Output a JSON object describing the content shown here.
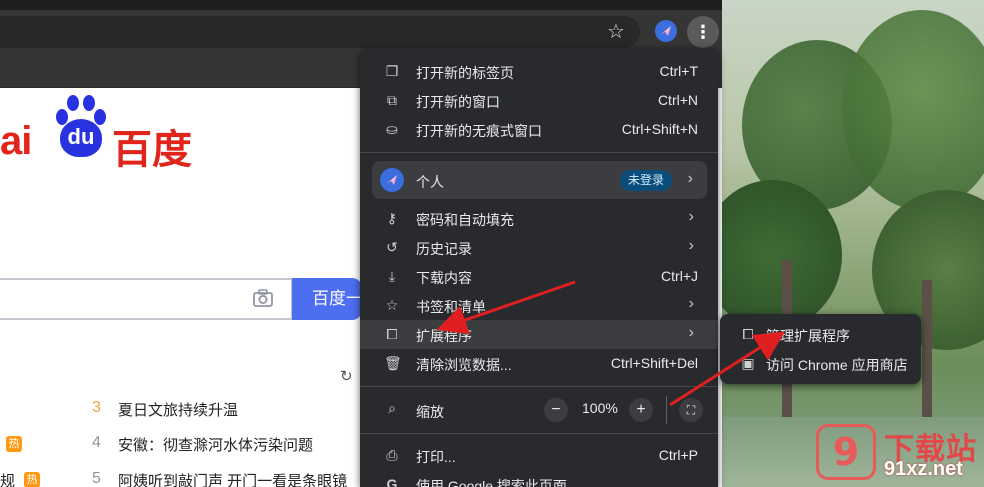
{
  "browser": {
    "star_icon": "star-icon",
    "menu_icon": "three-dots-vertical-icon"
  },
  "page": {
    "logo_latin": "ai",
    "logo_paw_text": "du",
    "logo_chinese": "百度",
    "search_button": "百度一",
    "hot_list": [
      {
        "num": "3",
        "text": "夏日文旅持续升温"
      },
      {
        "num": "4",
        "text": "安徽：彻查滁河水体污染问题"
      },
      {
        "num": "5",
        "text": "阿姨听到敲门声 开门一看是条眼镜"
      }
    ],
    "left_hot_badge": "热",
    "left_fragment": "规",
    "left_fragment_badge": "热"
  },
  "menu": {
    "items_top": [
      {
        "label": "打开新的标签页",
        "shortcut": "Ctrl+T",
        "icon": "new-tab-icon"
      },
      {
        "label": "打开新的窗口",
        "shortcut": "Ctrl+N",
        "icon": "new-window-icon"
      },
      {
        "label": "打开新的无痕式窗口",
        "shortcut": "Ctrl+Shift+N",
        "icon": "incognito-icon"
      }
    ],
    "profile": {
      "label": "个人",
      "badge": "未登录"
    },
    "items_mid": [
      {
        "label": "密码和自动填充",
        "icon": "key-icon"
      },
      {
        "label": "历史记录",
        "icon": "history-icon"
      },
      {
        "label": "下载内容",
        "shortcut": "Ctrl+J",
        "icon": "download-icon"
      },
      {
        "label": "书签和清单",
        "icon": "bookmark-star-icon"
      },
      {
        "label": "扩展程序",
        "icon": "puzzle-icon"
      },
      {
        "label": "清除浏览数据...",
        "shortcut": "Ctrl+Shift+Del",
        "icon": "trash-icon"
      }
    ],
    "zoom": {
      "label": "缩放",
      "minus": "−",
      "value": "100%",
      "plus": "+"
    },
    "items_bottom": [
      {
        "label": "打印...",
        "shortcut": "Ctrl+P",
        "icon": "print-icon"
      },
      {
        "label": "使用 Google 搜索此页面",
        "icon": "google-icon"
      }
    ]
  },
  "submenu": {
    "items": [
      {
        "label": "管理扩展程序",
        "icon": "puzzle-icon"
      },
      {
        "label": "访问 Chrome 应用商店",
        "icon": "chrome-webstore-icon"
      }
    ]
  },
  "watermark": {
    "badge": "9",
    "title": "下载站",
    "url": "91xz.net"
  },
  "colors": {
    "menu_bg": "#292a2d",
    "highlight": "#3c3d41",
    "baidu_red": "#e1251b",
    "baidu_blue": "#2932e1",
    "search_blue": "#4e6ef2",
    "arrow_red": "#e02020"
  }
}
